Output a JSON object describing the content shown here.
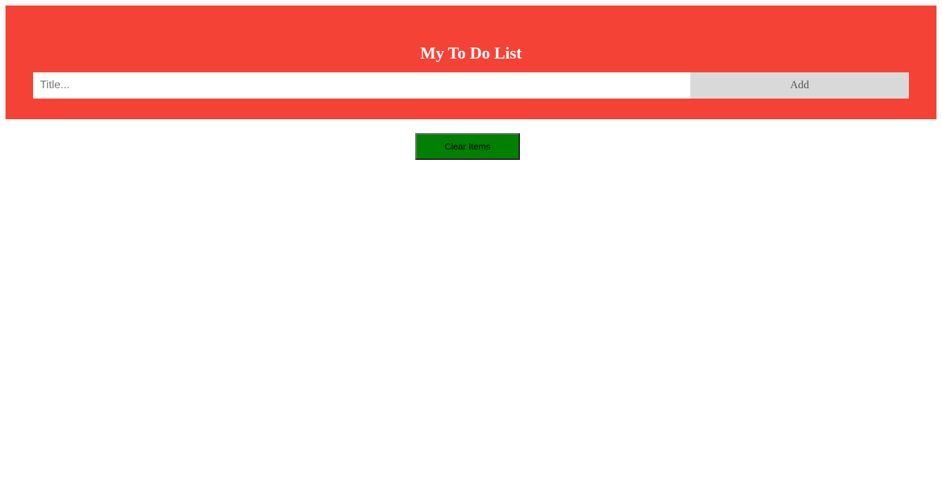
{
  "header": {
    "title": "My To Do List",
    "input_placeholder": "Title...",
    "input_value": "",
    "add_label": "Add",
    "background_color": "#f44336"
  },
  "actions": {
    "clear_label": "Clear Items",
    "clear_color": "#008000"
  },
  "todo_items": []
}
